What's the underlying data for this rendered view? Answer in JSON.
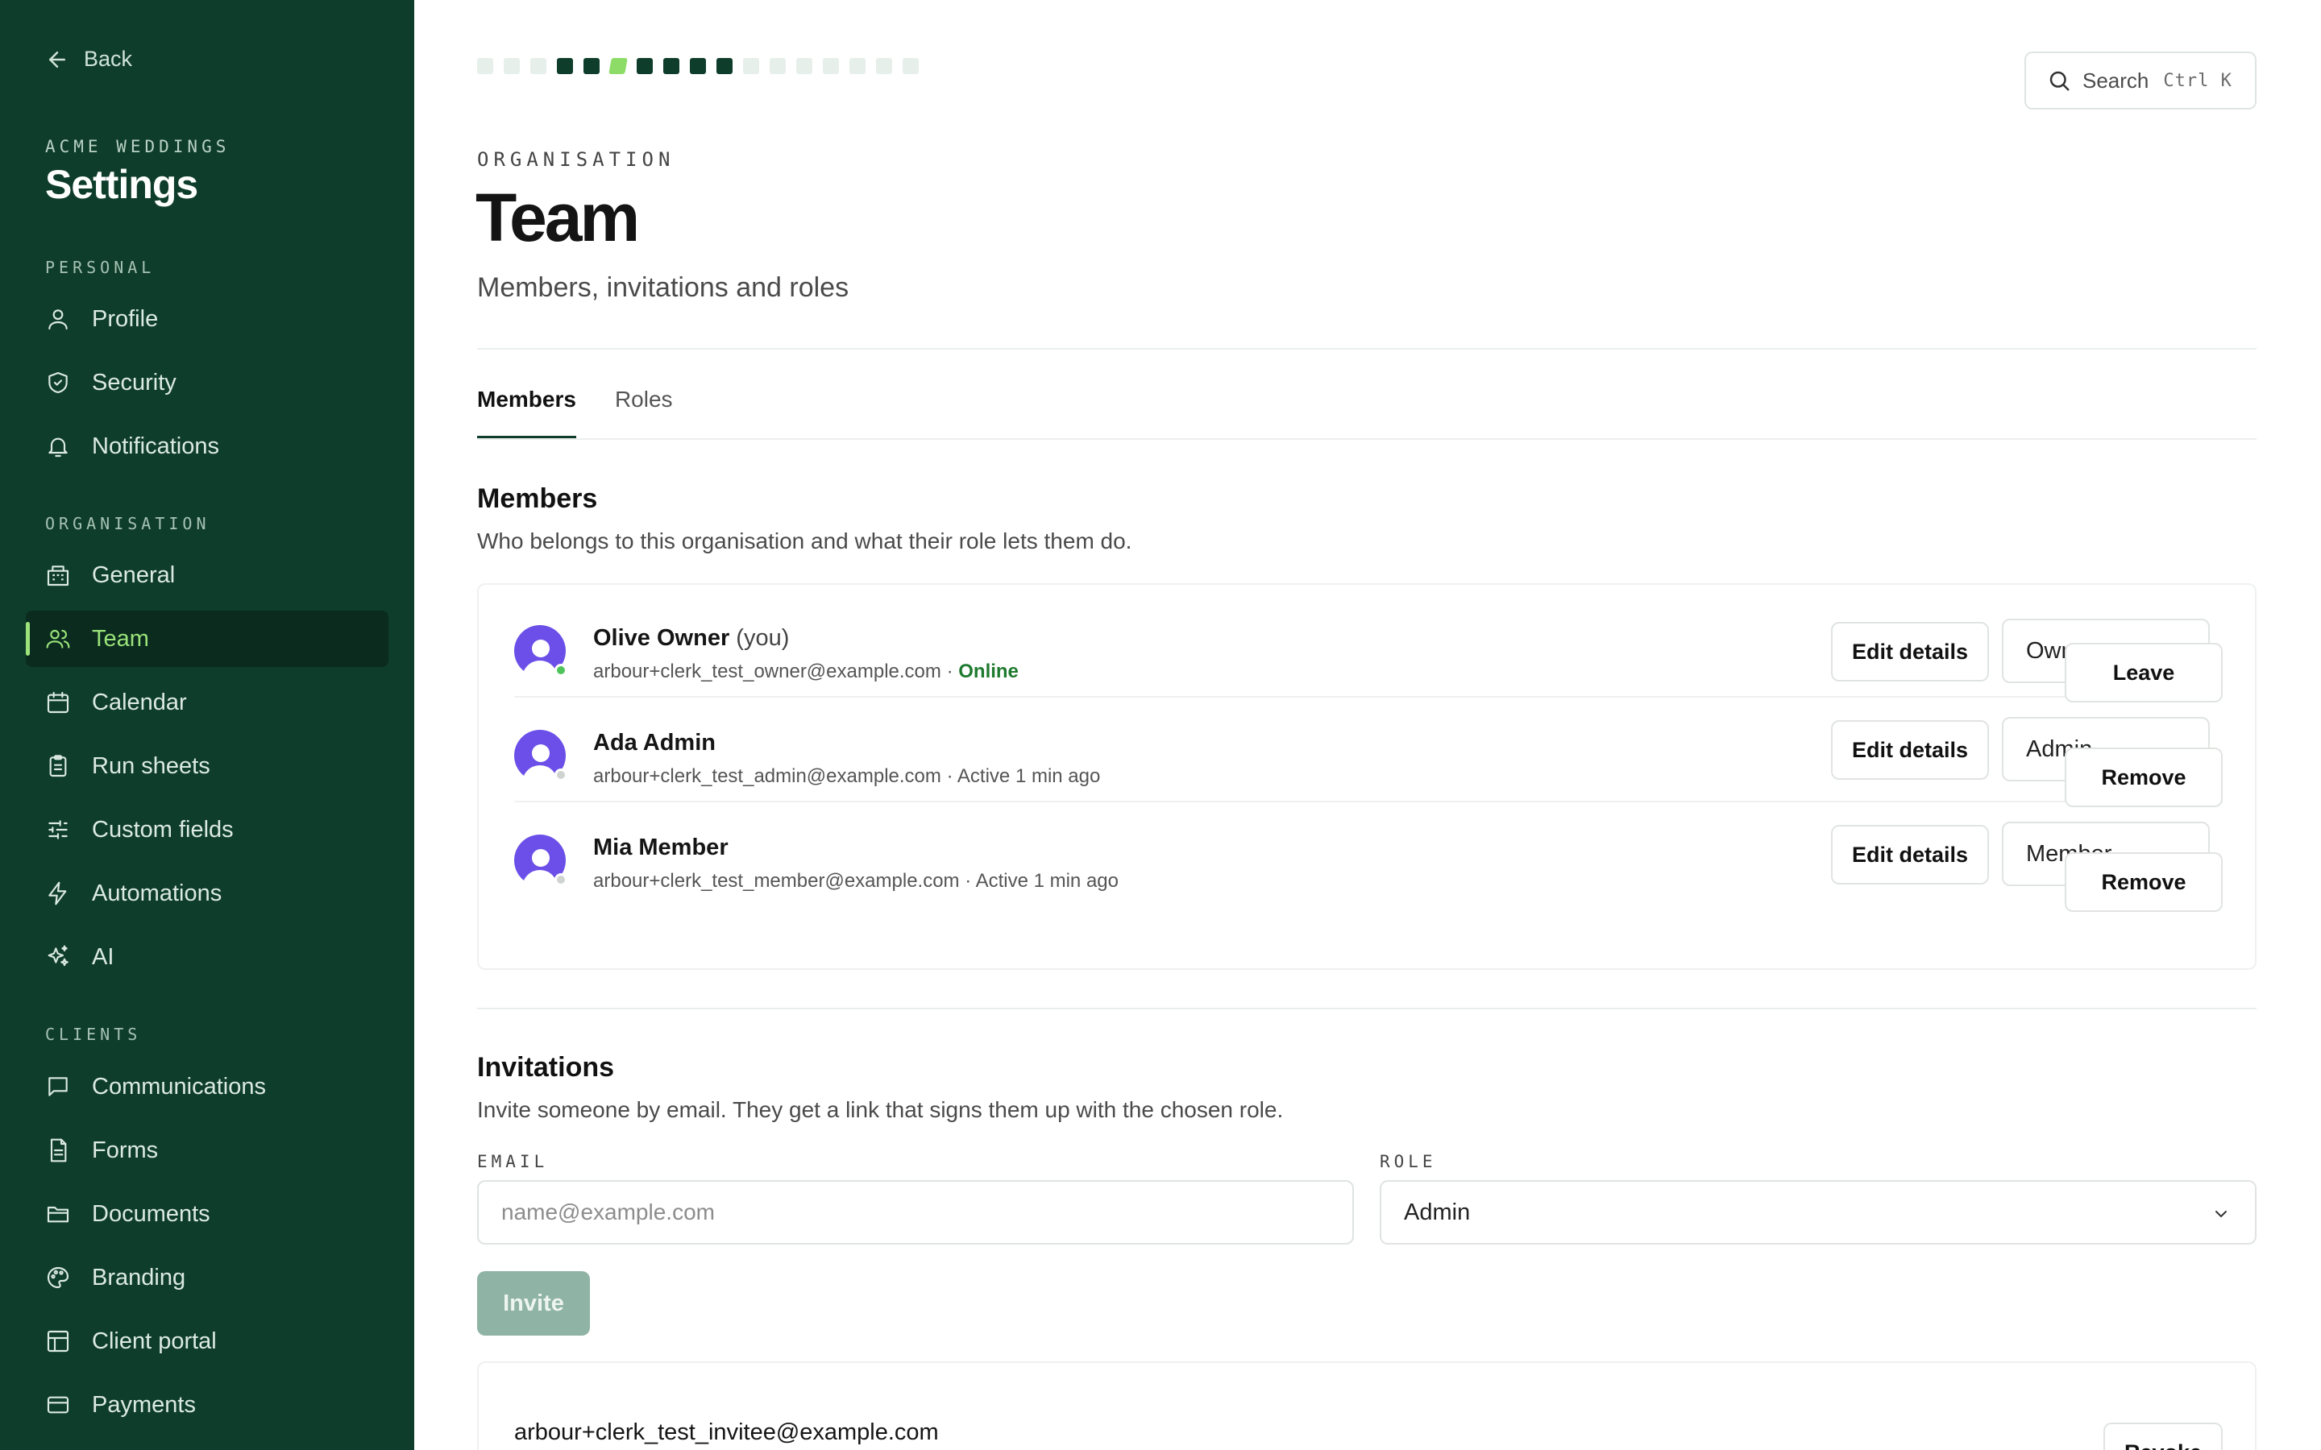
{
  "sidebar": {
    "back_label": "Back",
    "org_name": "ACME WEDDINGS",
    "title": "Settings",
    "sections": {
      "personal": "PERSONAL",
      "organisation": "ORGANISATION",
      "clients": "CLIENTS"
    },
    "items": {
      "profile": "Profile",
      "security": "Security",
      "notifications": "Notifications",
      "general": "General",
      "team": "Team",
      "calendar": "Calendar",
      "run_sheets": "Run sheets",
      "custom_fields": "Custom fields",
      "automations": "Automations",
      "ai": "AI",
      "communications": "Communications",
      "forms": "Forms",
      "documents": "Documents",
      "branding": "Branding",
      "client_portal": "Client portal",
      "payments": "Payments"
    },
    "active_item": "Team"
  },
  "progress": {
    "total_steps": 17,
    "completed_steps": 9,
    "current_step": 5
  },
  "search": {
    "label": "Search",
    "shortcut": "Ctrl K"
  },
  "header": {
    "eyebrow": "ORGANISATION",
    "title": "Team",
    "subtitle": "Members, invitations and roles"
  },
  "tabs": {
    "members": "Members",
    "roles": "Roles",
    "active": "Members"
  },
  "members_section": {
    "title": "Members",
    "description": "Who belongs to this organisation and what their role lets them do.",
    "edit_label": "Edit details",
    "rows": [
      {
        "name": "Olive Owner",
        "you_suffix": "(you)",
        "email": "arbour+clerk_test_owner@example.com",
        "separator": " · ",
        "status": "Online",
        "role": "Owner",
        "action": "Leave"
      },
      {
        "name": "Ada Admin",
        "email": "arbour+clerk_test_admin@example.com",
        "separator": " · ",
        "status": "Active 1 min ago",
        "role": "Admin",
        "action": "Remove"
      },
      {
        "name": "Mia Member",
        "email": "arbour+clerk_test_member@example.com",
        "separator": " · ",
        "status": "Active 1 min ago",
        "role": "Member",
        "action": "Remove"
      }
    ]
  },
  "invitations_section": {
    "title": "Invitations",
    "description": "Invite someone by email. They get a link that signs them up with the chosen role.",
    "email_label": "EMAIL",
    "email_placeholder": "name@example.com",
    "role_label": "ROLE",
    "role_value": "Admin",
    "invite_label": "Invite",
    "pending": [
      {
        "email": "arbour+clerk_test_invitee@example.com",
        "action": "Revoke"
      }
    ]
  },
  "colors": {
    "sidebar_bg": "#0f3d2b",
    "accent": "#9be37a",
    "avatar": "#6b4fe8",
    "online": "#1e7a2e",
    "invite_button": "#8fb3a5"
  }
}
